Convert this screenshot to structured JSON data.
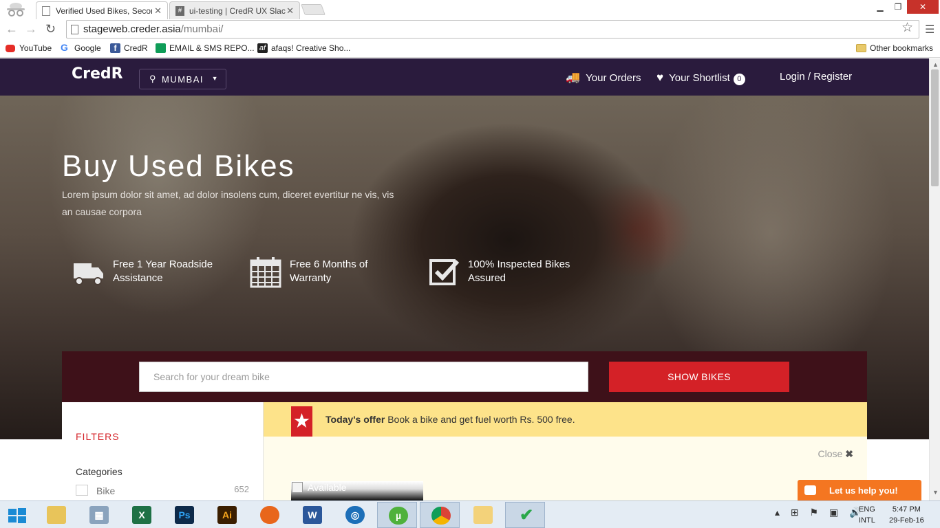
{
  "browser": {
    "tabs": [
      {
        "title": "Verified Used Bikes, Secon",
        "active": true
      },
      {
        "title": "ui-testing | CredR UX Slac",
        "active": false
      }
    ],
    "url_host": "stageweb.creder.asia",
    "url_path": "/mumbai/",
    "bookmarks": [
      "YouTube",
      "Google",
      "CredR",
      "EMAIL & SMS REPO...",
      "afaqs! Creative Sho..."
    ],
    "other_bookmarks": "Other bookmarks",
    "icons": {
      "back": "back-arrow-icon",
      "forward": "forward-arrow-icon",
      "reload": "reload-icon",
      "star": "bookmark-star-icon",
      "menu": "hamburger-menu-icon"
    }
  },
  "site": {
    "logo": "CredR",
    "city": "MUMBAI",
    "nav": {
      "orders": "Your Orders",
      "shortlist": "Your Shortlist",
      "shortlist_count": "0",
      "login": "Login / Register"
    },
    "hero": {
      "title": "Buy Used Bikes",
      "subtitle": "Lorem ipsum dolor sit amet, ad dolor insolens cum, diceret evertitur ne vis, vis an causae corpora",
      "features": [
        {
          "icon": "truck-icon",
          "line1": "Free 1 Year Roadside",
          "line2": "Assistance"
        },
        {
          "icon": "calendar-icon",
          "line1": "Free 6 Months of",
          "line2": "Warranty"
        },
        {
          "icon": "checkbox-icon",
          "line1": "100% Inspected Bikes",
          "line2": "Assured"
        }
      ]
    },
    "search": {
      "placeholder": "Search for your dream bike",
      "button": "SHOW BIKES"
    },
    "filters": {
      "title": "FILTERS",
      "categories_title": "Categories",
      "categories": [
        {
          "label": "Bike",
          "count": "652"
        }
      ]
    },
    "offer": {
      "label": "Today's offer",
      "text": "Book a bike and get fuel worth Rs. 500 free.",
      "close": "Close"
    },
    "listing": {
      "image_alt": "Available"
    },
    "chat": {
      "label": "Let us help you!"
    },
    "colors": {
      "header": "#2a1b3d",
      "search_band": "#3e1119",
      "accent": "#d42127",
      "offer_bg": "#fde38a",
      "chat": "#f47621"
    }
  },
  "taskbar": {
    "apps": [
      "explorer",
      "calculator",
      "excel",
      "photoshop",
      "illustrator",
      "firefox",
      "word",
      "network",
      "utorrent",
      "chrome",
      "windows-explorer",
      "checkmark-app"
    ],
    "language_line1": "ENG",
    "language_line2": "INTL",
    "time": "5:47 PM",
    "date": "29-Feb-16"
  }
}
